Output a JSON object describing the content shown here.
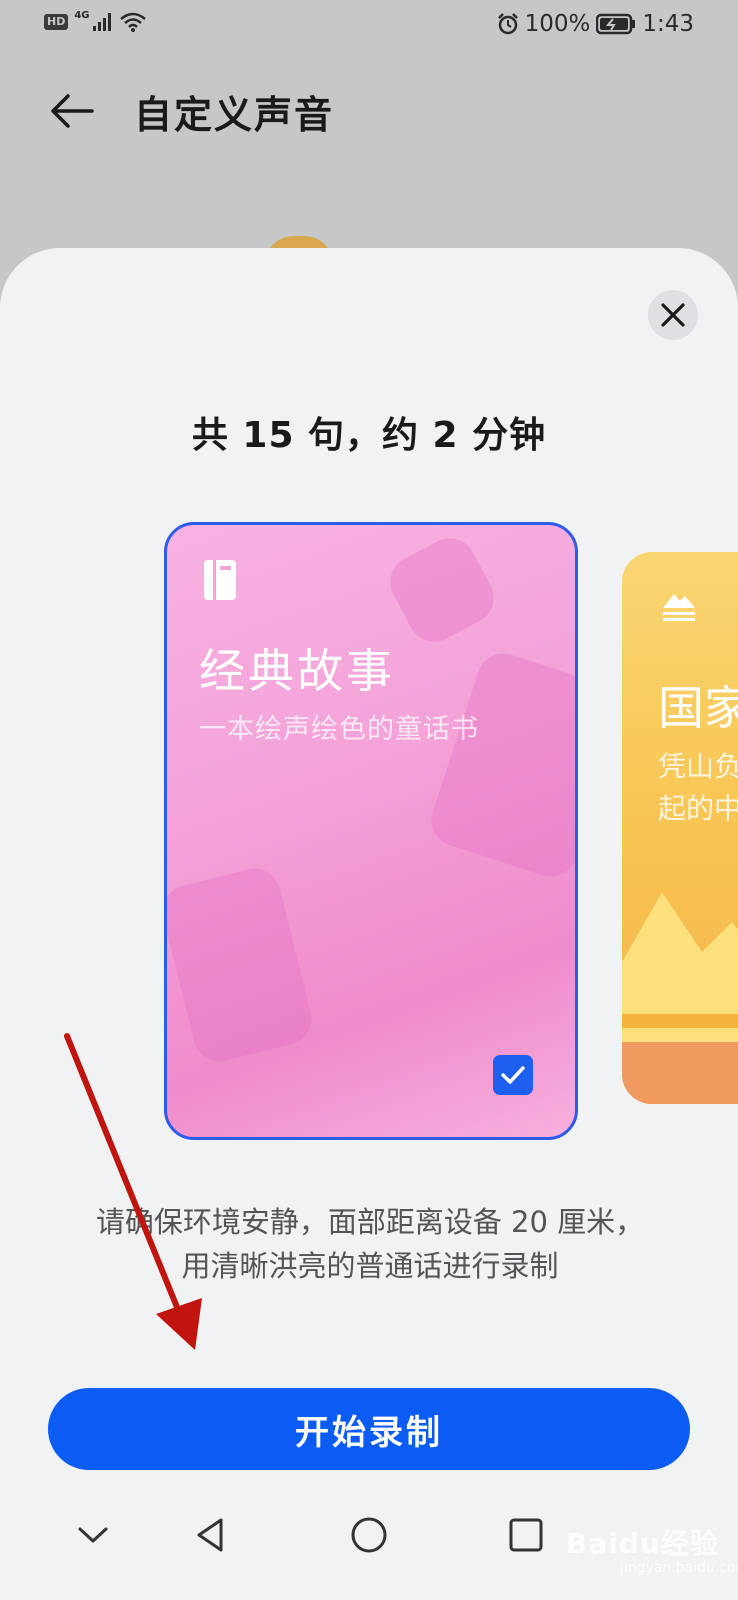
{
  "status_bar": {
    "hd": "HD",
    "network": "4G",
    "battery": "100%",
    "time": "1:43"
  },
  "app_bar": {
    "title": "自定义声音"
  },
  "sheet": {
    "headline": "共 15 句，约 2 分钟",
    "cards": [
      {
        "title": "经典故事",
        "subtitle": "一本绘声绘色的童话书",
        "selected": true
      },
      {
        "title": "国家",
        "subtitle_lines": [
          "凭山负",
          "起的中"
        ]
      }
    ],
    "hint_lines": [
      "请确保环境安静，面部距离设备 20 厘米，",
      "用清晰洪亮的普通话进行录制"
    ],
    "start_button": "开始录制"
  },
  "watermark": {
    "text": "Baidu经验",
    "sub": "jingyan.baidu.com"
  },
  "colors": {
    "accent": "#0b5cf5",
    "card_pink": "#f4a2d8",
    "card_yellow": "#f8c553",
    "annotation_arrow": "#c1140f"
  }
}
